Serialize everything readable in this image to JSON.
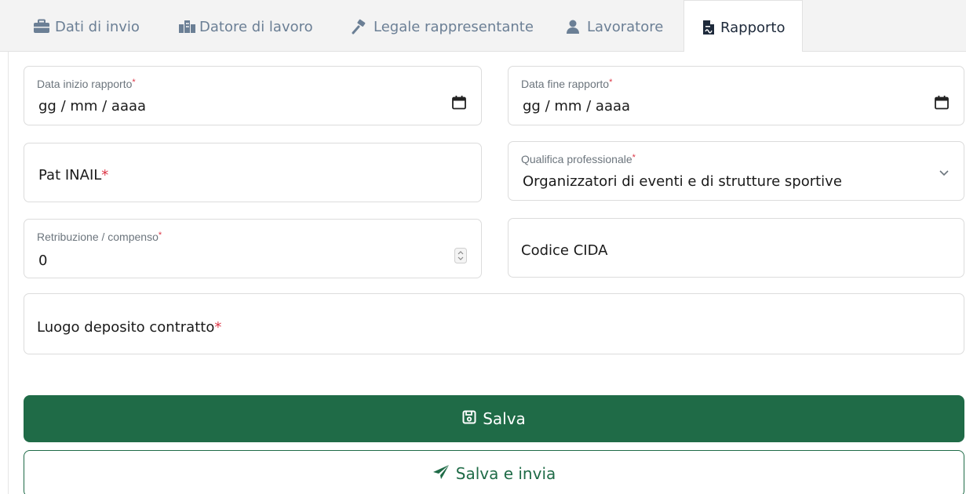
{
  "tabs": [
    {
      "label": "Dati di invio",
      "icon": "briefcase-icon"
    },
    {
      "label": "Datore di lavoro",
      "icon": "building-icon"
    },
    {
      "label": "Legale rappresentante",
      "icon": "gavel-icon"
    },
    {
      "label": "Lavoratore",
      "icon": "user-icon"
    },
    {
      "label": "Rapporto",
      "icon": "file-contract-icon"
    }
  ],
  "form": {
    "data_inizio": {
      "label": "Data inizio rapporto",
      "required_mark": "*",
      "value": "gg / mm / aaaa"
    },
    "data_fine": {
      "label": "Data fine rapporto",
      "required_mark": "*",
      "value": "gg / mm / aaaa"
    },
    "pat_inail": {
      "label": "Pat INAIL",
      "required_mark": "*"
    },
    "qualifica": {
      "label": "Qualifica professionale",
      "required_mark": "*",
      "value": "Organizzatori di eventi e di strutture sportive"
    },
    "retribuzione": {
      "label": "Retribuzione / compenso",
      "required_mark": "*",
      "value": "0"
    },
    "codice_cida": {
      "label": "Codice CIDA"
    },
    "luogo_deposito": {
      "label": "Luogo deposito contratto",
      "required_mark": "*"
    }
  },
  "buttons": {
    "save_label": "Salva",
    "save_send_label": "Salva e invia"
  },
  "colors": {
    "primary_green": "#1f6b47",
    "required_red": "#dc3545",
    "tab_inactive": "#6b7f95"
  }
}
